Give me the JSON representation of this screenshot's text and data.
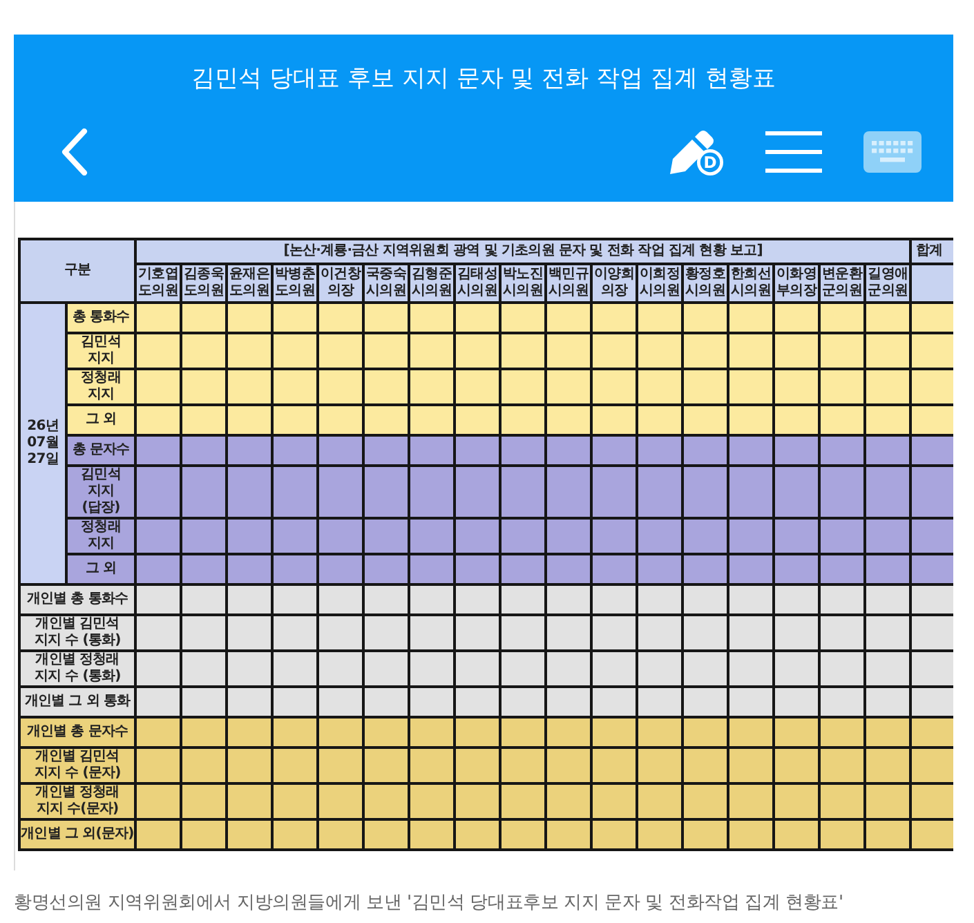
{
  "app_bar": {
    "title": "김민석 당대표 후보 지지 문자 및 전화 작업 집계 현황표",
    "pen_badge": "D"
  },
  "table": {
    "corner": "구분",
    "report_title": "[논산·계룡·금산 지역위원회 광역 및 기초의원 문자 및 전화 작업 집계 현황 보고]",
    "total_header": "합계",
    "members": [
      {
        "name": "기호엽",
        "title": "도의원"
      },
      {
        "name": "김종욱",
        "title": "도의원"
      },
      {
        "name": "윤재은",
        "title": "도의원"
      },
      {
        "name": "박병춘",
        "title": "도의원"
      },
      {
        "name": "이건창",
        "title": "의장"
      },
      {
        "name": "국중숙",
        "title": "시의원"
      },
      {
        "name": "김형준",
        "title": "시의원"
      },
      {
        "name": "김태성",
        "title": "시의원"
      },
      {
        "name": "박노진",
        "title": "시의원"
      },
      {
        "name": "백민규",
        "title": "시의원"
      },
      {
        "name": "이양희",
        "title": "의장"
      },
      {
        "name": "이희정",
        "title": "시의원"
      },
      {
        "name": "황정호",
        "title": "시의원"
      },
      {
        "name": "한희선",
        "title": "시의원"
      },
      {
        "name": "이화영",
        "title": "부의장"
      },
      {
        "name": "변운환",
        "title": "군의원"
      },
      {
        "name": "길영애",
        "title": "군의원"
      }
    ],
    "date_label": "26년 07월 27일",
    "dated_rows": [
      {
        "label": "총 통화수",
        "kind": "calls"
      },
      {
        "label": "김민석 지지",
        "kind": "calls"
      },
      {
        "label": "정청래 지지",
        "kind": "calls"
      },
      {
        "label": "그 외",
        "kind": "calls"
      },
      {
        "label": "총 문자수",
        "kind": "texts"
      },
      {
        "label": "김민석 지지 (답장)",
        "kind": "texts"
      },
      {
        "label": "정청래 지지",
        "kind": "texts"
      },
      {
        "label": "그 외",
        "kind": "texts"
      }
    ],
    "personal_rows": [
      {
        "label": "개인별 총 통화수",
        "kind": "calls"
      },
      {
        "label": "개인별 김민석 지지 수 (통화)",
        "kind": "calls"
      },
      {
        "label": "개인별 정청래 지지 수 (통화)",
        "kind": "calls"
      },
      {
        "label": "개인별 그 외 통화",
        "kind": "calls"
      },
      {
        "label": "개인별 총 문자수",
        "kind": "texts"
      },
      {
        "label": "개인별 김민석 지지 수 (문자)",
        "kind": "texts"
      },
      {
        "label": "개인별 정청래 지지 수(문자)",
        "kind": "texts"
      },
      {
        "label": "개인별 그 외(문자)",
        "kind": "texts"
      }
    ]
  },
  "caption": "황명선의원 지역위원회에서 지방의원들에게 보낸 '김민석 당대표후보 지지 문자 및 전화작업 집계 현황표'"
}
